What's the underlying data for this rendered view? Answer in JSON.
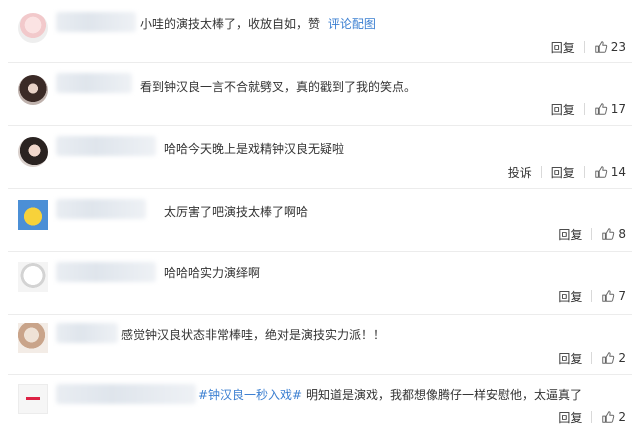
{
  "comments": [
    {
      "text": "小哇的演技太棒了，收放自如，赞",
      "link": "评论配图",
      "actions": [
        "回复"
      ],
      "likes": "23"
    },
    {
      "text": "看到钟汉良一言不合就劈叉，真的戳到了我的笑点。",
      "actions": [
        "回复"
      ],
      "likes": "17"
    },
    {
      "text": "哈哈今天晚上是戏精钟汉良无疑啦",
      "actions": [
        "投诉",
        "回复"
      ],
      "likes": "14"
    },
    {
      "text": "太厉害了吧演技太棒了啊哈",
      "actions": [
        "回复"
      ],
      "likes": "8"
    },
    {
      "text": "哈哈哈实力演绎啊",
      "actions": [
        "回复"
      ],
      "likes": "7"
    },
    {
      "text": "感觉钟汉良状态非常棒哇，绝对是演技实力派！！",
      "actions": [
        "回复"
      ],
      "likes": "2"
    },
    {
      "tag": "#钟汉良一秒入戏#",
      "text": " 明知道是演戏，我都想像腾仔一样安慰他，太逼真了",
      "actions": [
        "回复"
      ],
      "likes": "2"
    }
  ],
  "colors": {
    "link": "#3b7fd1",
    "tag": "#eb7350",
    "text": "#333333"
  },
  "icons": {
    "like": "thumbs-up-icon"
  }
}
